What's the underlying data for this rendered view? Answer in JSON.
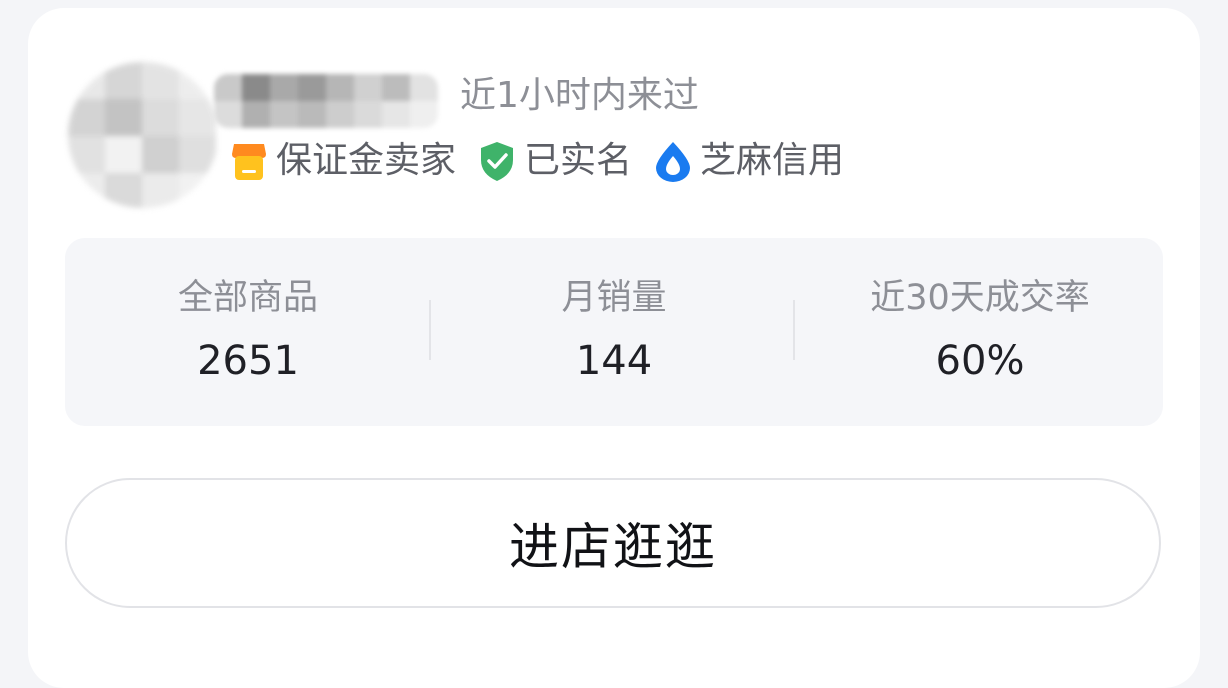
{
  "seller": {
    "last_seen": "近1小时内来过",
    "badges": [
      {
        "icon": "storefront-icon",
        "label": "保证金卖家",
        "color": "#ffb21e"
      },
      {
        "icon": "shield-check-icon",
        "label": "已实名",
        "color": "#3fb36a"
      },
      {
        "icon": "sesame-credit-icon",
        "label": "芝麻信用",
        "color": "#1a7bf0"
      }
    ]
  },
  "stats": [
    {
      "label": "全部商品",
      "value": "2651"
    },
    {
      "label": "月销量",
      "value": "144"
    },
    {
      "label": "近30天成交率",
      "value": "60%"
    }
  ],
  "enter_button": {
    "label": "进店逛逛"
  },
  "colors": {
    "card_background": "#ffffff",
    "page_background": "#f4f5f8",
    "stats_background": "#f5f6f9",
    "muted_text": "#8d8f96",
    "primary_text": "#1f2026"
  }
}
